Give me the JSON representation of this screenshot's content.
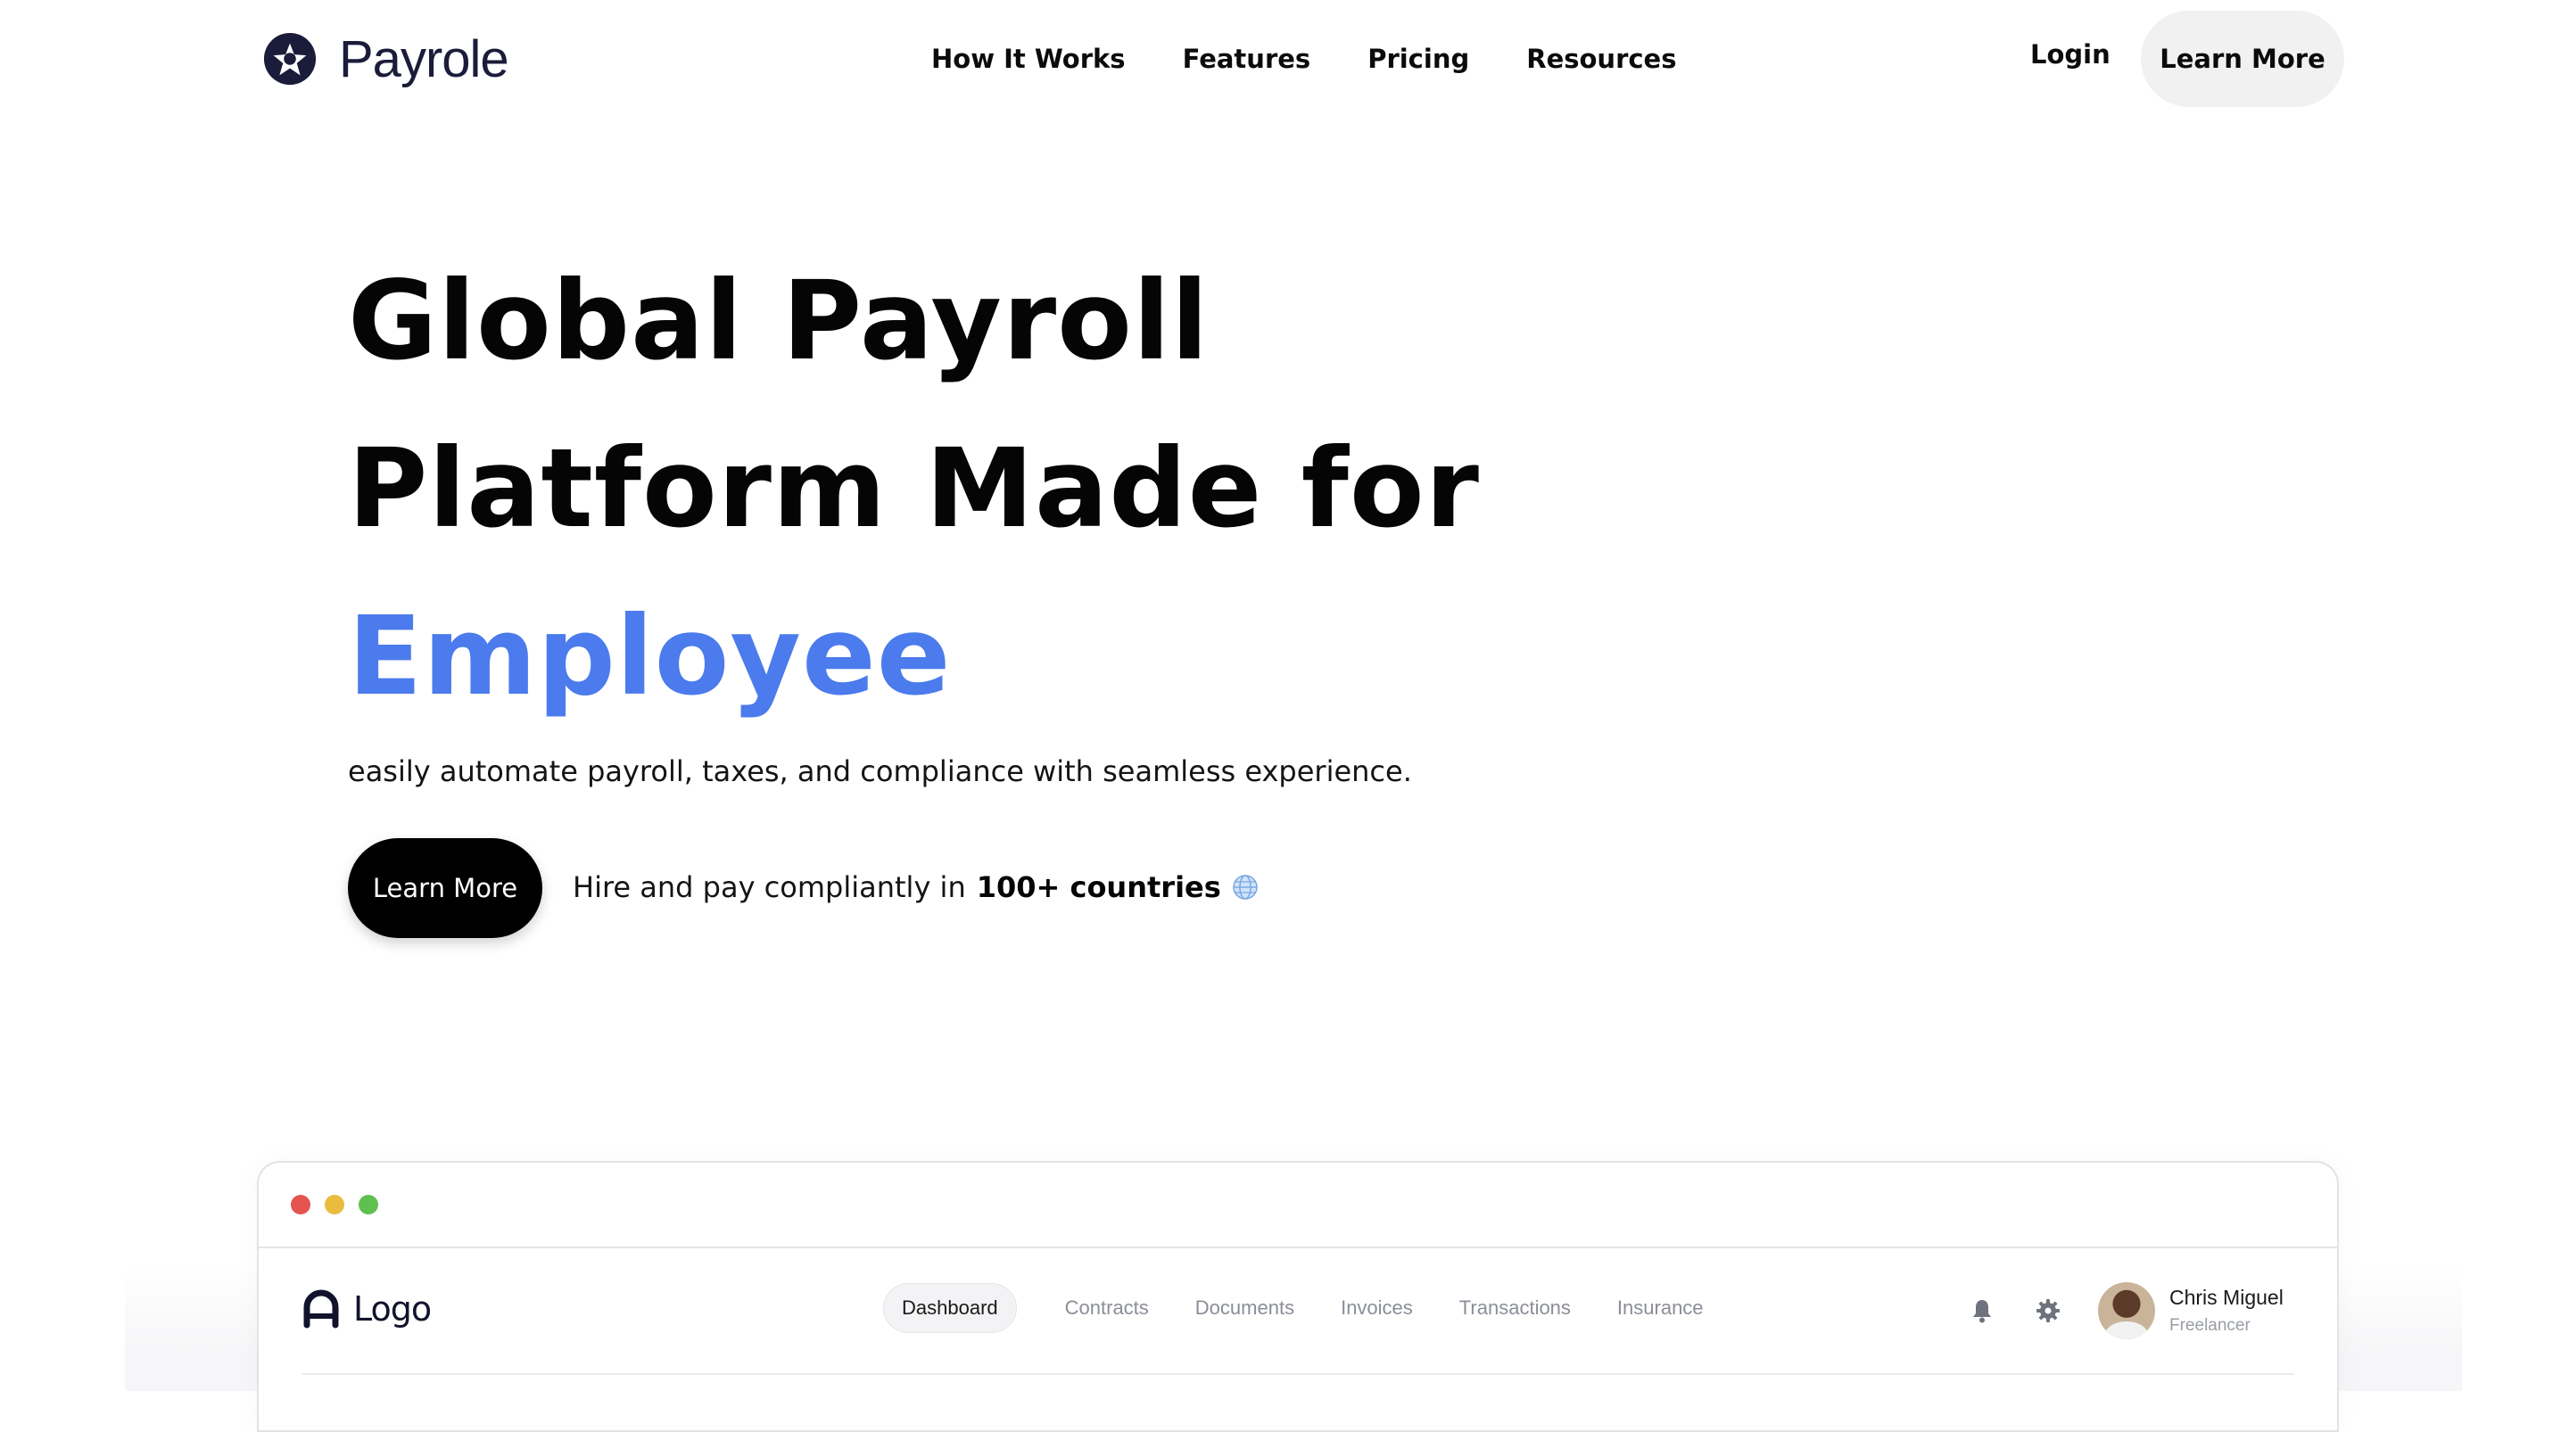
{
  "brand": {
    "name": "Payrole"
  },
  "nav": {
    "items": [
      "How It Works",
      "Features",
      "Pricing",
      "Resources"
    ],
    "login": "Login",
    "cta": "Learn More"
  },
  "hero": {
    "line1": "Global Payroll",
    "line2": "Platform Made for",
    "line3": "Employee",
    "accent_color": "#4b7bec",
    "subtitle": "easily automate payroll, taxes, and compliance with seamless experience.",
    "cta": "Learn More",
    "hire_prefix": "Hire and pay compliantly in",
    "hire_bold": "100+ countries",
    "hire_icon": "globe-icon"
  },
  "app_preview": {
    "window_dots": [
      "#e5544f",
      "#eabb3f",
      "#5fbf4f"
    ],
    "logo_text": "Logo",
    "tabs": [
      "Dashboard",
      "Contracts",
      "Documents",
      "Invoices",
      "Transactions",
      "Insurance"
    ],
    "active_tab": "Dashboard",
    "icons": [
      "bell-icon",
      "gear-icon"
    ],
    "user": {
      "name": "Chris Miguel",
      "role": "Freelancer"
    }
  }
}
